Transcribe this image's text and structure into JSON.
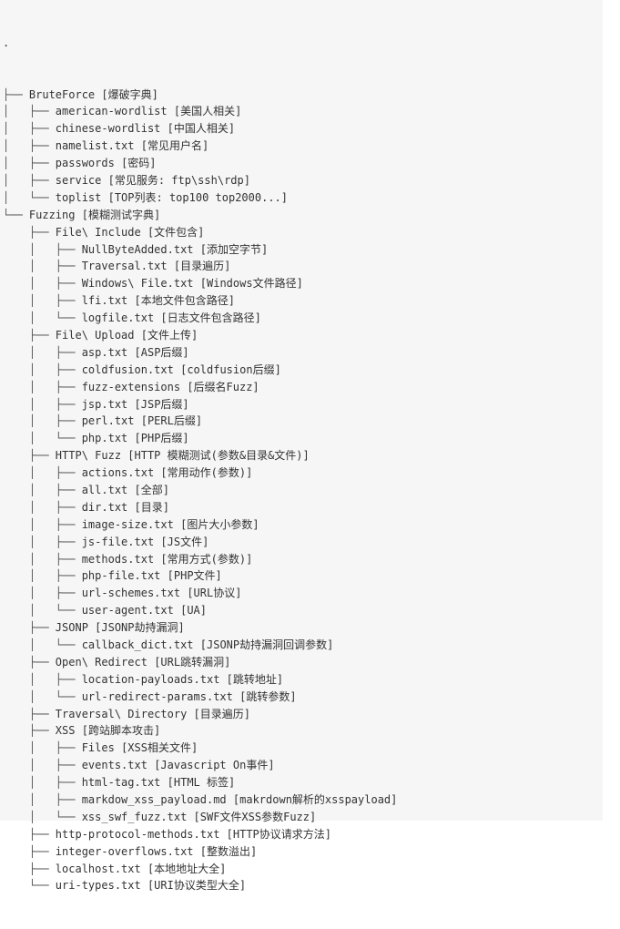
{
  "root": ".",
  "tree": [
    {
      "prefix": "├── ",
      "name": "BruteForce",
      "desc": "[爆破字典]"
    },
    {
      "prefix": "│   ├── ",
      "name": "american-wordlist",
      "desc": "[美国人相关]"
    },
    {
      "prefix": "│   ├── ",
      "name": "chinese-wordlist",
      "desc": "[中国人相关]"
    },
    {
      "prefix": "│   ├── ",
      "name": "namelist.txt",
      "desc": "[常见用户名]"
    },
    {
      "prefix": "│   ├── ",
      "name": "passwords",
      "desc": "[密码]"
    },
    {
      "prefix": "│   ├── ",
      "name": "service",
      "desc": "[常见服务: ftp\\ssh\\rdp]"
    },
    {
      "prefix": "│   └── ",
      "name": "toplist",
      "desc": "[TOP列表: top100 top2000...]"
    },
    {
      "prefix": "└── ",
      "name": "Fuzzing",
      "desc": "[模糊测试字典]"
    },
    {
      "prefix": "    ├── ",
      "name": "File\\ Include",
      "desc": "[文件包含]"
    },
    {
      "prefix": "    │   ├── ",
      "name": "NullByteAdded.txt",
      "desc": "[添加空字节]"
    },
    {
      "prefix": "    │   ├── ",
      "name": "Traversal.txt",
      "desc": "[目录遍历]"
    },
    {
      "prefix": "    │   ├── ",
      "name": "Windows\\ File.txt",
      "desc": "[Windows文件路径]"
    },
    {
      "prefix": "    │   ├── ",
      "name": "lfi.txt",
      "desc": "[本地文件包含路径]"
    },
    {
      "prefix": "    │   └── ",
      "name": "logfile.txt",
      "desc": "[日志文件包含路径]"
    },
    {
      "prefix": "    ├── ",
      "name": "File\\ Upload",
      "desc": "[文件上传]"
    },
    {
      "prefix": "    │   ├── ",
      "name": "asp.txt",
      "desc": "[ASP后缀]"
    },
    {
      "prefix": "    │   ├── ",
      "name": "coldfusion.txt",
      "desc": "[coldfusion后缀]"
    },
    {
      "prefix": "    │   ├── ",
      "name": "fuzz-extensions",
      "desc": "[后缀名Fuzz]"
    },
    {
      "prefix": "    │   ├── ",
      "name": "jsp.txt",
      "desc": "[JSP后缀]"
    },
    {
      "prefix": "    │   ├── ",
      "name": "perl.txt",
      "desc": "[PERL后缀]"
    },
    {
      "prefix": "    │   └── ",
      "name": "php.txt",
      "desc": "[PHP后缀]"
    },
    {
      "prefix": "    ├── ",
      "name": "HTTP\\ Fuzz",
      "desc": "[HTTP 模糊测试(参数&目录&文件)]"
    },
    {
      "prefix": "    │   ├── ",
      "name": "actions.txt",
      "desc": "[常用动作(参数)]"
    },
    {
      "prefix": "    │   ├── ",
      "name": "all.txt",
      "desc": "[全部]"
    },
    {
      "prefix": "    │   ├── ",
      "name": "dir.txt",
      "desc": "[目录]"
    },
    {
      "prefix": "    │   ├── ",
      "name": "image-size.txt",
      "desc": "[图片大小参数]"
    },
    {
      "prefix": "    │   ├── ",
      "name": "js-file.txt",
      "desc": "[JS文件]"
    },
    {
      "prefix": "    │   ├── ",
      "name": "methods.txt",
      "desc": "[常用方式(参数)]"
    },
    {
      "prefix": "    │   ├── ",
      "name": "php-file.txt",
      "desc": "[PHP文件]"
    },
    {
      "prefix": "    │   ├── ",
      "name": "url-schemes.txt",
      "desc": "[URL协议]"
    },
    {
      "prefix": "    │   └── ",
      "name": "user-agent.txt",
      "desc": "[UA]"
    },
    {
      "prefix": "    ├── ",
      "name": "JSONP",
      "desc": "[JSONP劫持漏洞]"
    },
    {
      "prefix": "    │   └── ",
      "name": "callback_dict.txt",
      "desc": "[JSONP劫持漏洞回调参数]"
    },
    {
      "prefix": "    ├── ",
      "name": "Open\\ Redirect",
      "desc": "[URL跳转漏洞]"
    },
    {
      "prefix": "    │   ├── ",
      "name": "location-payloads.txt",
      "desc": "[跳转地址]"
    },
    {
      "prefix": "    │   └── ",
      "name": "url-redirect-params.txt",
      "desc": "[跳转参数]"
    },
    {
      "prefix": "    ├── ",
      "name": "Traversal\\ Directory",
      "desc": "[目录遍历]"
    },
    {
      "prefix": "    ├── ",
      "name": "XSS",
      "desc": "[跨站脚本攻击]"
    },
    {
      "prefix": "    │   ├── ",
      "name": "Files",
      "desc": "[XSS相关文件]"
    },
    {
      "prefix": "    │   ├── ",
      "name": "events.txt",
      "desc": "[Javascript On事件]"
    },
    {
      "prefix": "    │   ├── ",
      "name": "html-tag.txt",
      "desc": "[HTML 标签]"
    },
    {
      "prefix": "    │   ├── ",
      "name": "markdow_xss_payload.md",
      "desc": "[makrdown解析的xsspayload]"
    },
    {
      "prefix": "    │   └── ",
      "name": "xss_swf_fuzz.txt",
      "desc": "[SWF文件XSS参数Fuzz]"
    },
    {
      "prefix": "    ├── ",
      "name": "http-protocol-methods.txt",
      "desc": "[HTTP协议请求方法]"
    },
    {
      "prefix": "    ├── ",
      "name": "integer-overflows.txt",
      "desc": "[整数溢出]"
    },
    {
      "prefix": "    ├── ",
      "name": "localhost.txt",
      "desc": "[本地地址大全]"
    },
    {
      "prefix": "    └── ",
      "name": "uri-types.txt",
      "desc": "[URI协议类型大全]"
    }
  ]
}
